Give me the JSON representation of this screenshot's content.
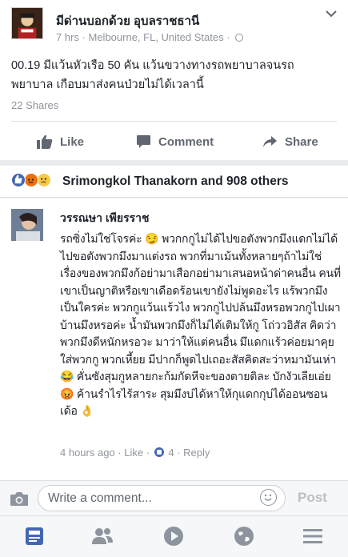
{
  "post": {
    "author": "มีด่านบอกด้วย อุบลราชธานี",
    "time": "7 hrs",
    "location": "Melbourne, FL, United States",
    "separator": "·",
    "text": "00.19 มีแว้นหัวเรือ 50 คัน แว้นขวางทางรถพยาบาลจนรถพยาบาล เกือบมาส่งคนป่วยไม่ได้เวลานี้",
    "shares": "22 Shares",
    "actions": {
      "like": "Like",
      "comment": "Comment",
      "share": "Share"
    }
  },
  "reactions": {
    "summary": "Srimongkol Thanakorn and 908 others",
    "icons": [
      "like-icon",
      "angry-icon",
      "sad-icon"
    ]
  },
  "comment": {
    "author": "วรรณษา เพียรราช",
    "text": "รถซิ่งไม่ใช่โจรค่ะ 😏 พวกกกูไม่ได้ไปขอตังพวกมึงแดกไม่ได้ไปขอตังพวกมึงมาแต่งรถ พวกที่มาเม้นทั้งหลายๆถ้าไม่ใช่เรื่องของพวกมึงก้อย่ามาเสือกอย่ามาเสนอหน้าด่าคนอื่น คนที่เขาเป็นญาติหรือเขาเดือดร้อนเขายังไม่พูดอะไร แร้พวกมึงเป็นใครค่ะ พวกกูแว้นแร้วไง พวกกูไปปล้นมึงหรอพวกกูไปเผาบ้านมึงหรอค่ะ น้ำมันพวกมึงก็ไม่ได้เติมให้กู โถ่ววอิสัส คิดว่าพวกมึงดีหนักหรอวะ มาว่าให้แต่คนอื่น มึแดกแร้วค่อยมาคุยใส่พวกกู พวกเหี้ยย มีปากก็พูดไปเถอะสัสคิดสะว่าหมามันเห่า 😂 คั่นซังสุมกูหลายกะก้มกัดหีจะของตายติละ บักงัวเลียเอ่ย 😡 ค้านรำไรไร้สาระ สุมมึงบ่ได้หาให้กุแดกกุบ่ได้ออนซอนเด้อ 👌",
    "time": "4 hours ago",
    "dot": "·",
    "like_label": "Like",
    "like_count": "4",
    "reply_label": "Reply"
  },
  "composer": {
    "placeholder": "Write a comment...",
    "post_label": "Post"
  },
  "nav": {
    "items": [
      "news-feed-icon",
      "friends-icon",
      "video-icon",
      "globe-icon",
      "menu-icon"
    ],
    "active_color": "#4267b2",
    "inactive_color": "#8d949e"
  },
  "colors": {
    "accent": "#4267b2",
    "meta_text": "#90949c",
    "divider": "#dddfe2"
  }
}
